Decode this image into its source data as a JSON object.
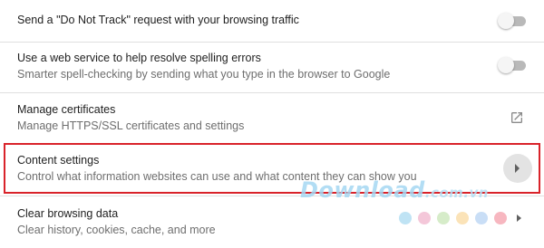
{
  "settings": {
    "do_not_track": {
      "title": "Send a \"Do Not Track\" request with your browsing traffic",
      "enabled": false
    },
    "spelling": {
      "title": "Use a web service to help resolve spelling errors",
      "subtitle": "Smarter spell-checking by sending what you type in the browser to Google",
      "enabled": false
    },
    "certificates": {
      "title": "Manage certificates",
      "subtitle": "Manage HTTPS/SSL certificates and settings",
      "icon": "open-in-new-icon"
    },
    "content_settings": {
      "title": "Content settings",
      "subtitle": "Control what information websites can use and what content they can show you",
      "icon": "chevron-right-icon",
      "highlight_color": "#d9232a"
    },
    "clear_data": {
      "title": "Clear browsing data",
      "subtitle": "Clear history, cookies, cache, and more",
      "icon": "chevron-right-icon"
    }
  },
  "watermark": {
    "main": "Download",
    "suffix": ".com.vn"
  },
  "decor_dot_colors": [
    "#bfe3f4",
    "#f4c7d9",
    "#d6ecc9",
    "#fbe3b8",
    "#c9def6",
    "#f7b7c0"
  ]
}
